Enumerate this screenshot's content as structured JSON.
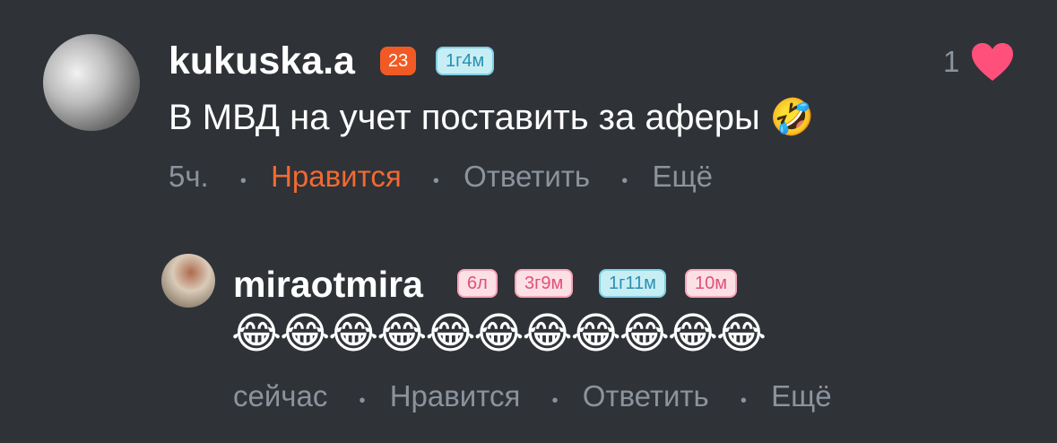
{
  "comment": {
    "username": "kukuska.a",
    "badges": [
      "23",
      "1г4м"
    ],
    "text": "В МВД на учет поставить за аферы",
    "emoji": "🤣",
    "time": "5ч.",
    "like_label": "Нравится",
    "reply_label": "Ответить",
    "more_label": "Ещё",
    "like_count": "1",
    "like_color": "#f06a33",
    "heart_color": "#ff4f7b"
  },
  "reply": {
    "username": "miraotmira",
    "badges": [
      "6л",
      "3г9м",
      "1г11м",
      "10м"
    ],
    "emoji_text": "😂😂😂😂😂😂😂😂😂😂😂",
    "time": "сейчас",
    "like_label": "Нравится",
    "reply_label": "Ответить",
    "more_label": "Ещё"
  }
}
